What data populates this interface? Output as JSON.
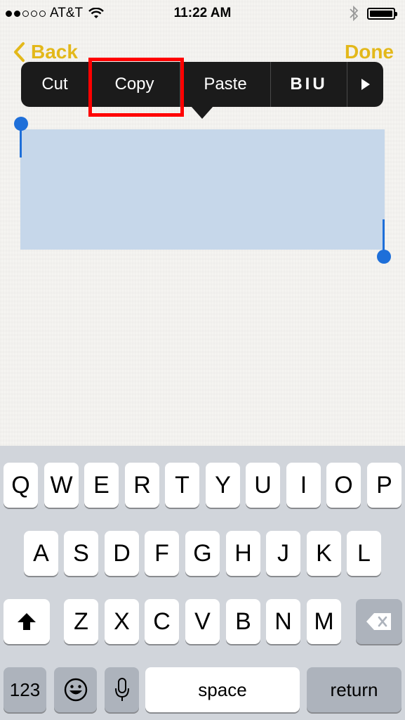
{
  "status_bar": {
    "carrier": "AT&T",
    "time": "11:22 AM"
  },
  "nav": {
    "back_label": "Back",
    "done_label": "Done"
  },
  "edit_menu": {
    "cut": "Cut",
    "copy": "Copy",
    "paste": "Paste",
    "format": "BIU"
  },
  "keyboard": {
    "row1": [
      "Q",
      "W",
      "E",
      "R",
      "T",
      "Y",
      "U",
      "I",
      "O",
      "P"
    ],
    "row2": [
      "A",
      "S",
      "D",
      "F",
      "G",
      "H",
      "J",
      "K",
      "L"
    ],
    "row3": [
      "Z",
      "X",
      "C",
      "V",
      "B",
      "N",
      "M"
    ],
    "numbers_label": "123",
    "space_label": "space",
    "return_label": "return"
  },
  "colors": {
    "accent": "#e3b81a",
    "selection": "#c6d7ea",
    "handle": "#1e6fd9",
    "highlight": "#ff0000"
  }
}
